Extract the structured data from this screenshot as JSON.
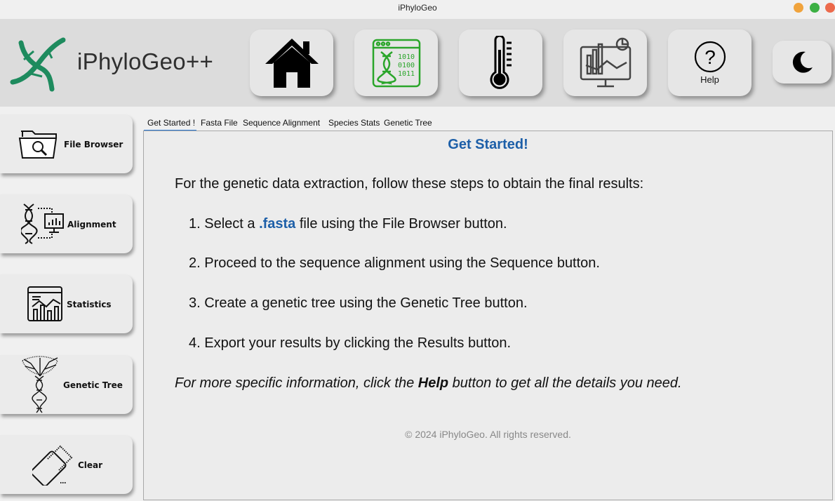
{
  "window": {
    "title": "iPhyloGeo"
  },
  "colors": {
    "accent": "#1d5fa8",
    "tab_indicator": "#2a7ad6",
    "dna_green": "#1e8b5e"
  },
  "header": {
    "brand": "iPhyloGeo++",
    "buttons": [
      {
        "icon": "home-icon"
      },
      {
        "icon": "dna-data-icon"
      },
      {
        "icon": "thermometer-icon"
      },
      {
        "icon": "dashboard-chart-icon"
      },
      {
        "icon": "help-icon",
        "label": "Help"
      },
      {
        "icon": "moon-icon"
      }
    ]
  },
  "sidebar": {
    "items": [
      {
        "label": "File Browser",
        "icon": "folder-search-icon"
      },
      {
        "label": "Alignment",
        "icon": "dna-alignment-icon"
      },
      {
        "label": "Statistics",
        "icon": "statistics-icon"
      },
      {
        "label": "Genetic Tree",
        "icon": "dna-tree-icon"
      },
      {
        "label": "Clear",
        "icon": "eraser-icon"
      }
    ]
  },
  "tabs": [
    "Get Started !",
    "Fasta File",
    "Sequence Alignment",
    "Species Stats",
    "Genetic Tree"
  ],
  "main": {
    "heading": "Get Started!",
    "intro": "For the genetic data extraction, follow these steps to obtain the final results:",
    "step1": {
      "num": "1. Select a ",
      "highlight": ".fasta",
      "rest": " file using the File Browser button."
    },
    "step2": "2. Proceed to the sequence alignment using the Sequence button.",
    "step3": "3. Create a genetic tree using the Genetic Tree button.",
    "step4": "4. Export your results by clicking the Results button.",
    "more": {
      "pre": "For more specific information, click the ",
      "bold": "Help",
      "post": " button to get all the details you need."
    },
    "footer": "© 2024 iPhyloGeo. All rights reserved."
  }
}
